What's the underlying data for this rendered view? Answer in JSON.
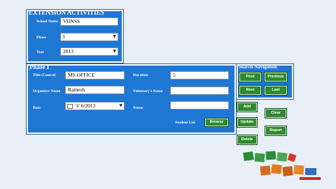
{
  "extension_panel": {
    "legend": "EXTENSION ACTIVITIES",
    "school_name_label": "School Name",
    "school_name_value": "VIINSS",
    "phase_label": "Phase",
    "phase_value": "I",
    "year_label": "Year",
    "year_value": "2013"
  },
  "phase_panel": {
    "legend": "Phase I",
    "title_label": "Title    (Course)",
    "title_value": "MS OFFICE",
    "organizer_label": "Organizer Name",
    "organizer_value": "Ramesh",
    "date_label": "Date",
    "date_value": "3/ 6/2013",
    "duration_label": "Duration",
    "duration_value": "5",
    "voluntary_label": "Voluntary's Name",
    "voluntary_value": "",
    "venue_label": "Venue",
    "venue_value": "",
    "student_list_label": "Student List",
    "browse_label": "Browse"
  },
  "search_nav": {
    "legend": "Search Navigation",
    "first": "First",
    "previous": "Previous",
    "next": "Next",
    "last": "Last"
  },
  "actions": {
    "add": "Add",
    "clear": "Clear",
    "update": "Update",
    "report": "Report",
    "delete": "Delete"
  },
  "icons": {
    "dropdown": "chevron-down-icon",
    "calendar": "calendar-icon",
    "logo": "clipart-logo"
  },
  "colors": {
    "panel_blue": "#1f77d4",
    "button_green": "#2f8a2f",
    "background": "#e9eff6"
  }
}
